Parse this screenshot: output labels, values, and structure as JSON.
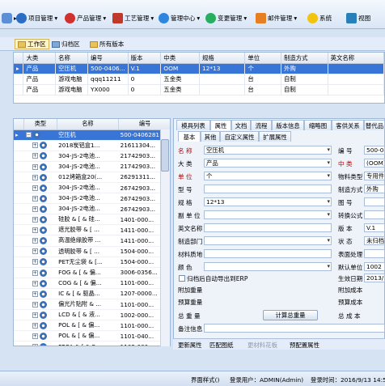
{
  "menubar": {
    "items": [
      {
        "label": "项目管理",
        "color": "#2b6cc4"
      },
      {
        "label": "产品管理",
        "color": "#d0312d"
      },
      {
        "label": "工艺管理",
        "color": "#c0392b"
      },
      {
        "label": "管理中心",
        "color": "#2e86de"
      },
      {
        "label": "变更管理",
        "color": "#27ae60"
      },
      {
        "label": "邮件管理",
        "color": "#e67e22"
      },
      {
        "label": "系统",
        "color": "#f1c40f"
      },
      {
        "label": "视图",
        "color": "#2980b9"
      }
    ]
  },
  "toolbar2": {
    "workspace": "工作区",
    "archive": "归档区",
    "all_versions": "所有版本"
  },
  "top_grid": {
    "columns": [
      "大类",
      "名称",
      "编号",
      "版本",
      "中类",
      "规格",
      "单位",
      "制造方式",
      "英文名称"
    ],
    "rows": [
      [
        "产品",
        "空压机",
        "500-0406...",
        "V.1",
        "OOM",
        "12*13",
        "个",
        "外购",
        ""
      ],
      [
        "产品",
        "游戏电脑",
        "qqq11211",
        "0",
        "五金类",
        "",
        "台",
        "自制",
        ""
      ],
      [
        "产品",
        "游戏电脑",
        "YX000",
        "0",
        "五金类",
        "",
        "台",
        "自制",
        ""
      ]
    ]
  },
  "tree_grid": {
    "columns": [
      "类型",
      "名称",
      "编号"
    ],
    "rows": [
      {
        "name": "空压机",
        "code": "500-0406281",
        "sel": true
      },
      {
        "name": "2018炭铝盒1...",
        "code": "21611304..."
      },
      {
        "name": "304-JS-2电池...",
        "code": "21742903..."
      },
      {
        "name": "304-JS-2电池...",
        "code": "21742903..."
      },
      {
        "name": "012烤箱盒20(...",
        "code": "26291311..."
      },
      {
        "name": "304-JS-2电池...",
        "code": "26742903..."
      },
      {
        "name": "304-JS-2电池...",
        "code": "26742903..."
      },
      {
        "name": "304-JS-2电池...",
        "code": "26742903..."
      },
      {
        "name": "硅胶 & [ & 硅...",
        "code": "1401-000..."
      },
      {
        "name": "遮光胶带 & [ ...",
        "code": "1411-000..."
      },
      {
        "name": "高温绝缘胶带 ...",
        "code": "1411-000..."
      },
      {
        "name": "透明胶带 & [ ...",
        "code": "1504-000..."
      },
      {
        "name": "PET无尘袋 & [...",
        "code": "1504-000..."
      },
      {
        "name": "FOG & [ & 偏...",
        "code": "3006-0356..."
      },
      {
        "name": "COG & [ & 偏...",
        "code": "1101-000..."
      },
      {
        "name": "IC & [ & 驱晶...",
        "code": "1207-0000..."
      },
      {
        "name": "偏光片贴附 & ...",
        "code": "1101-000..."
      },
      {
        "name": "LCD & [ & 液...",
        "code": "1002-000..."
      },
      {
        "name": "POL & [ & 偏...",
        "code": "1101-000..."
      },
      {
        "name": "POL & [ & 偏...",
        "code": "1101-040..."
      },
      {
        "name": "FPCA & [ & F...",
        "code": "1102-000..."
      },
      {
        "name": "",
        "code": ""
      }
    ]
  },
  "right_tabs_top": [
    "模具列表",
    "属性",
    "文档",
    "流程",
    "版本信息",
    "缩略图",
    "客供关系",
    "替代品"
  ],
  "right_tabs_sub": [
    "基本",
    "其他",
    "自定义属性",
    "扩展属性"
  ],
  "form": {
    "name_label": "名 称",
    "name_value": "空压机",
    "code_label": "编 号",
    "code_value": "500-04",
    "major_label": "大 类",
    "major_value": "产品",
    "mid_label": "中 类",
    "mid_value": "(OOM)",
    "unit_label": "单 位",
    "unit_value": "个",
    "mattype_label": "物料类型",
    "mattype_value": "专用件",
    "model_label": "型 号",
    "model_value": "",
    "make_label": "制造方式",
    "make_value": "外购",
    "spec_label": "规 格",
    "spec_value": "12*13",
    "drawing_label": "图 号",
    "drawing_value": "",
    "subunit_label": "副 单 位",
    "subunit_value": "",
    "convert_label": "转换公式",
    "convert_value": "",
    "en_label": "英文名称",
    "en_value": "",
    "ver_label": "版 本",
    "ver_value": "V.1",
    "dept_label": "制造部门",
    "dept_value": "",
    "status_label": "状 态",
    "status_value": "未归档",
    "texture_label": "材料质地",
    "texture_value": "",
    "surface_label": "表面处理",
    "surface_value": "",
    "color_label": "颜 色",
    "color_value": "",
    "defunit_label": "默认单位",
    "defunit_value": "1002",
    "erp_label": "归档后自动导出到ERP",
    "effdate_label": "生效日期",
    "effdate_value": "2013/7",
    "addw_label": "附加重量",
    "addw_value": "",
    "addcost_label": "附加成本",
    "addcost_value": "",
    "estw_label": "预算重量",
    "estw_value": "",
    "estcost_label": "预算成本",
    "estcost_value": "",
    "totalw_label": "总 重 量",
    "totalw_value": "",
    "calc_button": "计算总重量",
    "totalcost_label": "总 成 本",
    "totalcost_value": "",
    "remark_label": "备注信息",
    "remark_value": ""
  },
  "bottom_bar": {
    "update": "更新属性",
    "match": "匹配图纸",
    "more": "更材料花板",
    "preset": "预配置属性"
  },
  "statusbar": {
    "ui_style": "界面样式()",
    "login": "登录用户：ADMIN(Admin)",
    "login_time": "登录时间：2016/9/13 14:5"
  }
}
